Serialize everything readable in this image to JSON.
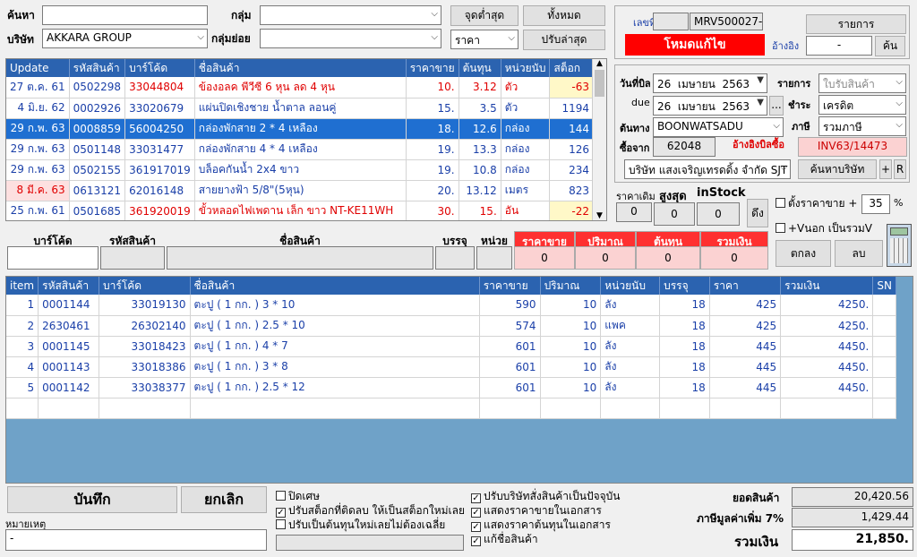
{
  "search": {
    "label": "ค้นหา",
    "value": "",
    "company_label": "บริษัท",
    "company_value": "AKKARA GROUP"
  },
  "group": {
    "label": "กลุ่ม",
    "value": "",
    "sub_label": "กลุ่มย่อย",
    "sub_value": ""
  },
  "filters": {
    "lowest": "จุดต่ำสุด",
    "all": "ทั้งหมด",
    "price_sel": "ราคา",
    "adjust_latest": "ปรับล่าสุด"
  },
  "product_grid": {
    "columns": [
      "Update",
      "รหัสสินค้า",
      "บาร์โค้ด",
      "ชื่อสินค้า",
      "ราคาขาย",
      "ต้นทุน",
      "หน่วยนับ",
      "สต็อก"
    ],
    "rows": [
      [
        "27 ต.ค. 61",
        "0502298",
        "33044804",
        "ข้องอลค พีวีซี 6 หุน ลด 4 หุน",
        "10.",
        "3.12",
        "ตัว",
        "-63"
      ],
      [
        "4 มิ.ย. 62",
        "0002926",
        "33020679",
        "แผ่นปิดเชิงชาย น้ำตาล ลอนคู่",
        "15.",
        "3.5",
        "ตัว",
        "1194"
      ],
      [
        "29 ก.พ. 63",
        "0008859",
        "56004250",
        "กล่องพักสาย 2 * 4 เหลือง",
        "18.",
        "12.6",
        "กล่อง",
        "144"
      ],
      [
        "29 ก.พ. 63",
        "0501148",
        "33031477",
        "กล่องพักสาย 4 * 4 เหลือง",
        "19.",
        "13.3",
        "กล่อง",
        "126"
      ],
      [
        "29 ก.พ. 63",
        "0502155",
        "361917019",
        "บล็อคกันน้ำ 2x4 ขาว",
        "19.",
        "10.8",
        "กล่อง",
        "234"
      ],
      [
        "8 มี.ค. 63",
        "0613121",
        "62016148",
        "สายยางฟ้า 5/8\"(5หุน)",
        "20.",
        "13.12",
        "เมตร",
        "823"
      ],
      [
        "25 ก.พ. 61",
        "0501685",
        "361920019",
        "ขั้วหลอดไฟเพดาน เล็ก ขาว NT-KE11WH",
        "30.",
        "15.",
        "อัน",
        "-22"
      ]
    ]
  },
  "doc": {
    "no_label": "เลขที่",
    "no_value": "MRV500027-",
    "mode": "โหมดแก้ไข",
    "list_btn": "รายการ",
    "ref_label": "อ้างอิง",
    "ref_value": "-",
    "find_btn": "ค้น"
  },
  "bill": {
    "date_label": "วันที่บิล",
    "date_day": "26",
    "date_month": "เมษายน",
    "date_year": "2563",
    "due_label": "due",
    "due_day": "26",
    "due_month": "เมษายน",
    "due_year": "2563",
    "more": "...",
    "source_label": "ต้นทาง",
    "source_value": "BOONWATSADU",
    "buy_from_label": "ซื้อจาก",
    "buy_from_value": "62048",
    "ref_bill_label": "อ้างอิงบิลซื้อ",
    "ref_bill_value": "INV63/14473",
    "supplier_value": "บริษัท แสงเจริญเทรดดิ้ง จำกัด SJT",
    "find_company_btn": "ค้นหาบริษัท",
    "plus": "+",
    "r": "R"
  },
  "side": {
    "items_label": "รายการ",
    "items_value": "ใบรับสินค้า",
    "pay_label": "ชำระ",
    "pay_value": "เครดิต",
    "tax_label": "ภาษี",
    "tax_value": "รวมภาษี"
  },
  "stock": {
    "orig_label": "ราคาเดิม",
    "max_label": "สูงสุด",
    "instock_label": "inStock",
    "v1": "0",
    "v2": "0",
    "v3": "0",
    "pull": "ดึง"
  },
  "options": {
    "set_price_label": "ตั้งราคาขาย +",
    "set_price_value": "35",
    "percent": "%",
    "vat_label": "+Vนอก เป็นรวมV",
    "ok": "ตกลง",
    "delete": "ลบ"
  },
  "entry": {
    "headers": [
      "บาร์โค้ด",
      "รหัสสินค้า",
      "ชื่อสินค้า",
      "บรรจุ",
      "หน่วย",
      "ราคาขาย",
      "ปริมาณ",
      "ต้นทุน",
      "รวมเงิน"
    ],
    "sale": "0",
    "qty": "0",
    "cost": "0",
    "total": "0"
  },
  "items_grid": {
    "columns": [
      "item",
      "รหัสสินค้า",
      "บาร์โค้ด",
      "ชื่อสินค้า",
      "ราคาขาย",
      "ปริมาณ",
      "หน่วยนับ",
      "บรรจุ",
      "ราคา",
      "รวมเงิน",
      "SN"
    ],
    "rows": [
      [
        "1",
        "0001144",
        "33019130",
        "ตะปู ( 1 กก. ) 3 * 10",
        "590",
        "10",
        "ลัง",
        "18",
        "425",
        "4250.",
        ""
      ],
      [
        "2",
        "2630461",
        "26302140",
        "ตะปู ( 1 กก. ) 2.5 * 10",
        "574",
        "10",
        "แพค",
        "18",
        "425",
        "4250.",
        ""
      ],
      [
        "3",
        "0001145",
        "33018423",
        "ตะปู ( 1 กก. ) 4 * 7",
        "601",
        "10",
        "ลัง",
        "18",
        "445",
        "4450.",
        ""
      ],
      [
        "4",
        "0001143",
        "33018386",
        "ตะปู ( 1 กก. ) 3 * 8",
        "601",
        "10",
        "ลัง",
        "18",
        "445",
        "4450.",
        ""
      ],
      [
        "5",
        "0001142",
        "33038377",
        "ตะปู ( 1 กก. ) 2.5 * 12",
        "601",
        "10",
        "ลัง",
        "18",
        "445",
        "4450.",
        ""
      ]
    ]
  },
  "bottom": {
    "save": "บันทึก",
    "cancel": "ยกเลิก",
    "note_label": "หมายเหตุ",
    "note_value": "-",
    "chk1": "ปิดเศษ",
    "chk2": "ปรับสต็อกที่ติดลบ ให้เป็นสต็อกใหม่เลย",
    "chk3": "ปรับเป็นต้นทุนใหม่เลยไม่ต้องเฉลี่ย",
    "chk4": "ปรับบริษัทสั่งสินค้าเป็นปัจจุบัน",
    "chk5": "แสดงราคาขายในเอกสาร",
    "chk6": "แสดงราคาต้นทุนในเอกสาร",
    "chk7": "แก้ชื่อสินค้า",
    "subtotal_label": "ยอดสินค้า",
    "subtotal_value": "20,420.56",
    "vat_label": "ภาษีมูลค่าเพิ่ม 7%",
    "vat_value": "1,429.44",
    "total_label": "รวมเงิน",
    "total_value": "21,850."
  }
}
